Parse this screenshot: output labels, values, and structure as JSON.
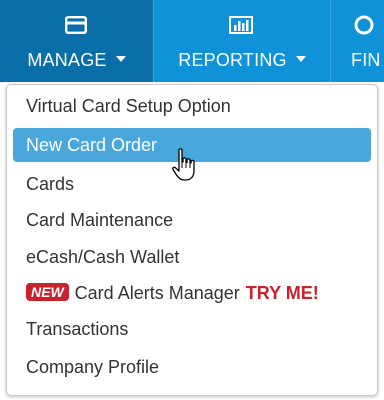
{
  "nav": {
    "items": [
      {
        "label": "MANAGE",
        "icon": "card-icon",
        "active": true
      },
      {
        "label": "REPORTING",
        "icon": "bar-chart-icon"
      },
      {
        "label": "FIN",
        "icon": "partial-circle-icon"
      }
    ]
  },
  "menu": {
    "items": [
      {
        "label": "Virtual Card Setup Option"
      },
      {
        "label": "New Card Order",
        "highlighted": true
      },
      {
        "label": "Cards"
      },
      {
        "label": "Card Maintenance"
      },
      {
        "label": "eCash/Cash Wallet"
      },
      {
        "label": "Card Alerts Manager",
        "badge": "NEW",
        "suffix": "TRY ME!"
      },
      {
        "label": "Transactions"
      },
      {
        "label": "Company Profile"
      }
    ]
  },
  "colors": {
    "nav_bg": "#0f92d7",
    "nav_active": "#0a6ea8",
    "highlight": "#4aa7dc",
    "badge": "#c8232c"
  }
}
